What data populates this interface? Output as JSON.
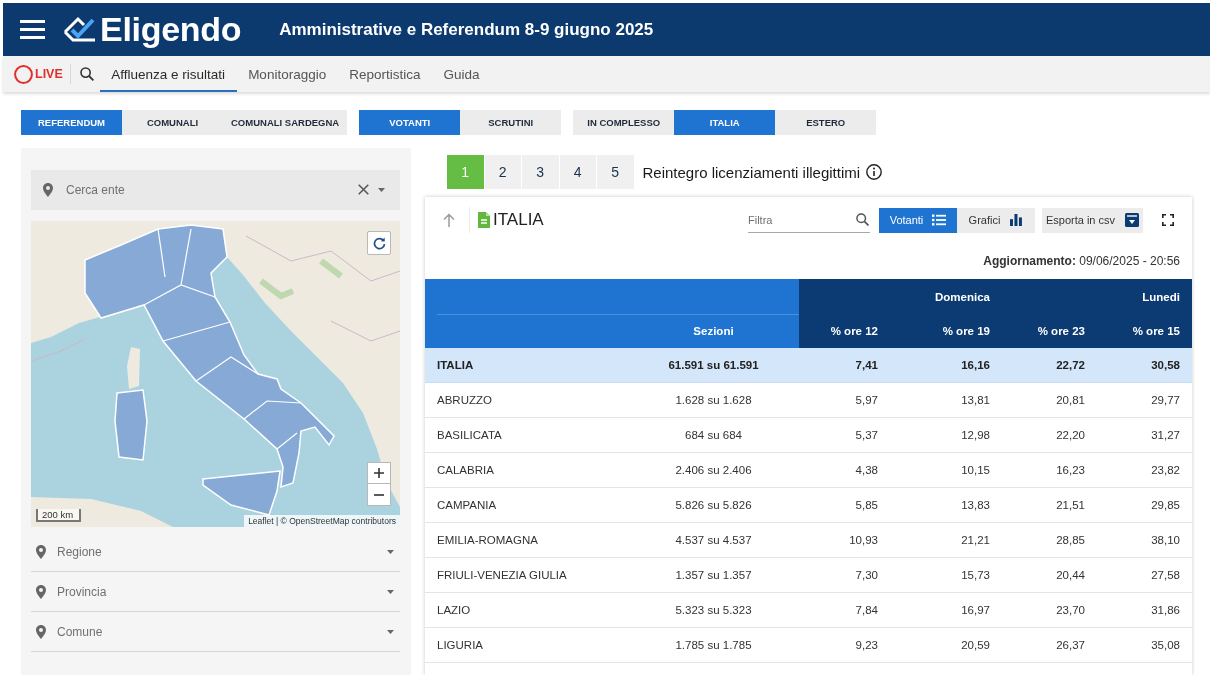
{
  "header": {
    "logo_text": "Eligendo",
    "title": "Amministrative e Referendum 8-9 giugno 2025"
  },
  "nav": {
    "live_label": "LIVE",
    "items": [
      {
        "label": "Affluenza e risultati",
        "selected": true
      },
      {
        "label": "Monitoraggio",
        "selected": false
      },
      {
        "label": "Reportistica",
        "selected": false
      },
      {
        "label": "Guida",
        "selected": false
      }
    ]
  },
  "filter_groups": [
    {
      "options": [
        {
          "label": "REFERENDUM",
          "selected": true
        },
        {
          "label": "COMUNALI",
          "selected": false
        },
        {
          "label": "COMUNALI SARDEGNA",
          "selected": false
        }
      ]
    },
    {
      "options": [
        {
          "label": "VOTANTI",
          "selected": true
        },
        {
          "label": "SCRUTINI",
          "selected": false
        }
      ]
    },
    {
      "options": [
        {
          "label": "IN COMPLESSO",
          "selected": false
        },
        {
          "label": "ITALIA",
          "selected": true
        },
        {
          "label": "ESTERO",
          "selected": false
        }
      ]
    }
  ],
  "sidebar": {
    "search": {
      "placeholder": "Cerca ente"
    },
    "map": {
      "scale": "200 km",
      "attribution": "Leaflet | © OpenStreetMap contributors"
    },
    "selects": [
      {
        "placeholder": "Regione"
      },
      {
        "placeholder": "Provincia"
      },
      {
        "placeholder": "Comune"
      }
    ]
  },
  "questions": {
    "tabs": [
      {
        "label": "1",
        "selected": true
      },
      {
        "label": "2",
        "selected": false
      },
      {
        "label": "3",
        "selected": false
      },
      {
        "label": "4",
        "selected": false
      },
      {
        "label": "5",
        "selected": false
      }
    ],
    "title": "Reintegro licenziamenti illegittimi"
  },
  "panel": {
    "title": "ITALIA",
    "filter": {
      "placeholder": "Filtra"
    },
    "views": [
      {
        "label": "Votanti",
        "kind": "list",
        "selected": true
      },
      {
        "label": "Grafici",
        "kind": "chart",
        "selected": false
      }
    ],
    "export": {
      "label": "Esporta in csv"
    },
    "updated": "**Aggiornamento:** 09/06/2025 - 20:56",
    "table": {
      "day_headers": [
        "Domenica",
        "Lunedi"
      ],
      "columns": [
        "",
        "Sezioni",
        "% ore 12",
        "% ore 19",
        "% ore 23",
        "% ore 15"
      ],
      "rows": [
        {
          "kind": "total",
          "cells": [
            "ITALIA",
            "61.591 su 61.591",
            "7,41",
            "16,16",
            "22,72",
            "30,58"
          ]
        },
        {
          "kind": "region",
          "cells": [
            "ABRUZZO",
            "1.628 su 1.628",
            "5,97",
            "13,81",
            "20,81",
            "29,77"
          ]
        },
        {
          "kind": "region",
          "cells": [
            "BASILICATA",
            "684 su 684",
            "5,37",
            "12,98",
            "22,20",
            "31,27"
          ]
        },
        {
          "kind": "region",
          "cells": [
            "CALABRIA",
            "2.406 su 2.406",
            "4,38",
            "10,15",
            "16,23",
            "23,82"
          ]
        },
        {
          "kind": "region",
          "cells": [
            "CAMPANIA",
            "5.826 su 5.826",
            "5,85",
            "13,83",
            "21,51",
            "29,85"
          ]
        },
        {
          "kind": "region",
          "cells": [
            "EMILIA-ROMAGNA",
            "4.537 su 4.537",
            "10,93",
            "21,21",
            "28,85",
            "38,10"
          ]
        },
        {
          "kind": "region",
          "cells": [
            "FRIULI-VENEZIA GIULIA",
            "1.357 su 1.357",
            "7,30",
            "15,73",
            "20,44",
            "27,58"
          ]
        },
        {
          "kind": "region",
          "cells": [
            "LAZIO",
            "5.323 su 5.323",
            "7,84",
            "16,97",
            "23,70",
            "31,86"
          ]
        },
        {
          "kind": "region",
          "cells": [
            "LIGURIA",
            "1.785 su 1.785",
            "9,23",
            "20,59",
            "26,37",
            "35,08"
          ]
        }
      ]
    }
  }
}
